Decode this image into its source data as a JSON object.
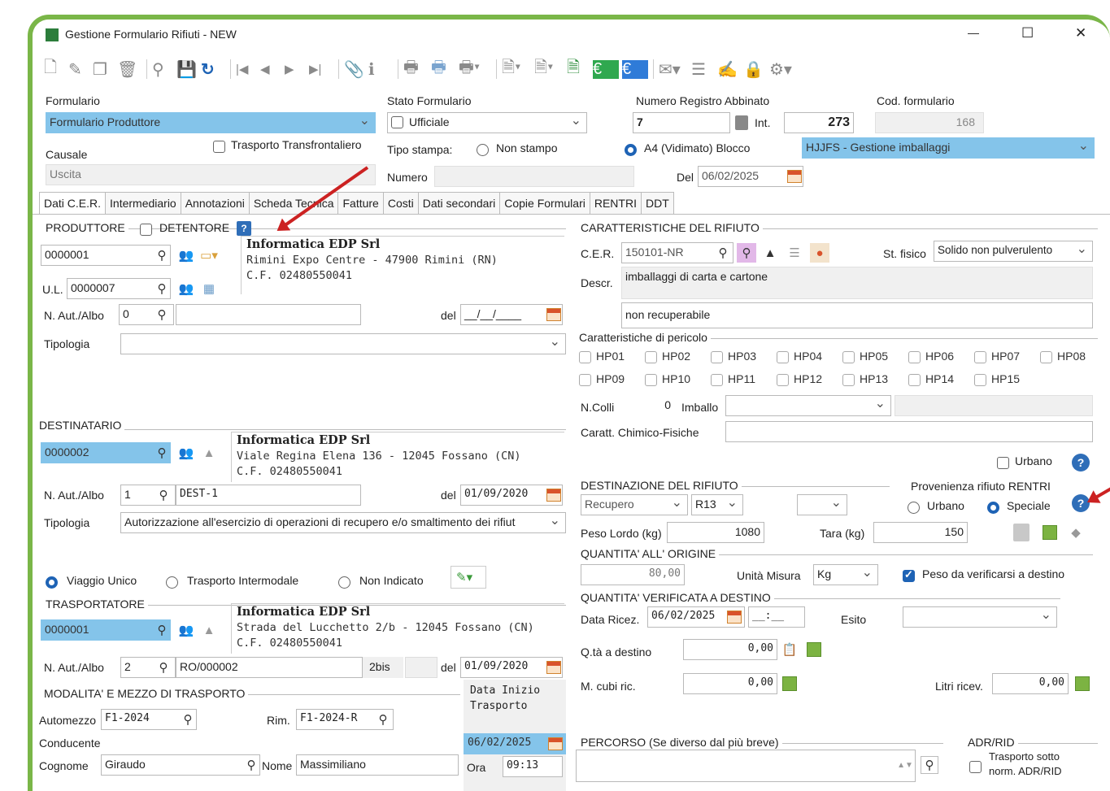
{
  "window": {
    "title": "Gestione Formulario Rifiuti - NEW",
    "min": "—",
    "max": "☐",
    "close": "✕"
  },
  "header": {
    "formulario_label": "Formulario",
    "formulario_value": "Formulario Produttore",
    "stato_label": "Stato Formulario",
    "stato_value": "Ufficiale",
    "numreg_label": "Numero Registro Abbinato",
    "numreg_value": "7",
    "int_label": "Int.",
    "int_value": "273",
    "cod_label": "Cod. formulario",
    "cod_value": "168",
    "causale_label": "Causale",
    "causale_value": "Uscita",
    "transfrontaliero_label": "Trasporto Transfrontaliero",
    "tipo_stampa_label": "Tipo stampa:",
    "non_stampo_label": "Non stampo",
    "a4_label": "A4 (Vidimato) Blocco",
    "blocco_value": "HJJFS - Gestione imballaggi",
    "numero_label": "Numero",
    "del_label": "Del",
    "del_value": "06/02/2025"
  },
  "tabs": [
    "Dati C.E.R.",
    "Intermediario",
    "Annotazioni",
    "Scheda Tecnica",
    "Fatture",
    "Costi",
    "Dati secondari",
    "Copie Formulari",
    "RENTRI",
    "DDT"
  ],
  "produttore": {
    "title": "PRODUTTORE",
    "detentore_label": "DETENTORE",
    "code": "0000001",
    "ul_label": "U.L.",
    "ul_value": "0000007",
    "name": "Informatica EDP Srl",
    "address": "Rimini Expo Centre - 47900 Rimini (RN)",
    "cf": "C.F. 02480550041",
    "aut_label": "N. Aut./Albo",
    "aut_value": "0",
    "del_label": "del",
    "del_value": "__/__/____",
    "tipologia_label": "Tipologia"
  },
  "destinatario": {
    "title": "DESTINATARIO",
    "code": "0000002",
    "name": "Informatica EDP Srl",
    "address": "Viale Regina Elena 136 - 12045 Fossano (CN)",
    "cf": "C.F. 02480550041",
    "aut_label": "N. Aut./Albo",
    "aut_value": "1",
    "aut_code": "DEST-1",
    "del_label": "del",
    "del_value": "01/09/2020",
    "tipologia_label": "Tipologia",
    "tipologia_value": "Autorizzazione all'esercizio di operazioni di recupero e/o smaltimento dei rifiut"
  },
  "viaggio": {
    "unico": "Viaggio Unico",
    "intermodale": "Trasporto Intermodale",
    "non_indicato": "Non Indicato"
  },
  "trasportatore": {
    "title": "TRASPORTATORE",
    "code": "0000001",
    "name": "Informatica EDP Srl",
    "address": "Strada del Lucchetto 2/b - 12045 Fossano (CN)",
    "cf": "C.F. 02480550041",
    "aut_label": "N. Aut./Albo",
    "aut_value": "2",
    "aut_code": "RO/000002",
    "bis_label": "2bis",
    "del_label": "del",
    "del_value": "01/09/2020"
  },
  "modalita": {
    "title": "MODALITA' E MEZZO DI TRASPORTO",
    "data_inizio_label": "Data Inizio Trasporto",
    "automezzo_label": "Automezzo",
    "automezzo_value": "F1-2024",
    "rim_label": "Rim.",
    "rim_value": "F1-2024-R",
    "conducente_label": "Conducente",
    "data_value": "06/02/2025",
    "cognome_label": "Cognome",
    "cognome_value": "Giraudo",
    "nome_label": "Nome",
    "nome_value": "Massimiliano",
    "ora_label": "Ora",
    "ora_value": "09:13"
  },
  "caratteristiche": {
    "title": "CARATTERISTICHE DEL RIFIUTO",
    "cer_label": "C.E.R.",
    "cer_value": "150101-NR",
    "st_fisico_label": "St. fisico",
    "st_fisico_value": "Solido non pulverulento",
    "descr_label": "Descr.",
    "descr_value": "imballaggi di carta e cartone",
    "descr2_value": "non recuperabile",
    "pericolo_label": "Caratteristiche di pericolo",
    "hp": [
      "HP01",
      "HP02",
      "HP03",
      "HP04",
      "HP05",
      "HP06",
      "HP07",
      "HP08",
      "HP09",
      "HP10",
      "HP11",
      "HP12",
      "HP13",
      "HP14",
      "HP15"
    ],
    "ncolli_label": "N.Colli",
    "ncolli_value": "0",
    "imballo_label": "Imballo",
    "chimico_label": "Caratt. Chimico-Fisiche",
    "urbano_label": "Urbano"
  },
  "destinazione": {
    "title": "DESTINAZIONE DEL RIFIUTO",
    "tipo_value": "Recupero",
    "codice_value": "R13",
    "provenienza_label": "Provenienza rifiuto RENTRI",
    "urbano_label": "Urbano",
    "speciale_label": "Speciale",
    "peso_lordo_label": "Peso Lordo (kg)",
    "peso_lordo_value": "1080",
    "tara_label": "Tara (kg)",
    "tara_value": "150"
  },
  "quantita": {
    "title": "QUANTITA' ALL' ORIGINE",
    "value": "80,00",
    "unita_label": "Unità Misura",
    "unita_value": "Kg",
    "verificarsi_label": "Peso da verificarsi a destino"
  },
  "verificata": {
    "title": "QUANTITA' VERIFICATA A DESTINO",
    "data_label": "Data Ricez.",
    "data_value": "06/02/2025",
    "ora_value": "__:__",
    "esito_label": "Esito",
    "qta_label": "Q.tà a destino",
    "qta_value": "0,00",
    "mcubi_label": "M. cubi ric.",
    "mcubi_value": "0,00",
    "litri_label": "Litri ricev.",
    "litri_value": "0,00"
  },
  "percorso": {
    "title": "PERCORSO (Se diverso dal più breve)",
    "adr_title": "ADR/RID",
    "adr_label_1": "Trasporto sotto",
    "adr_label_2": "norm. ADR/RID"
  },
  "colors": {
    "accent": "#84c4ea",
    "frame": "#7ab648",
    "arrow": "#cc2222",
    "help": "#2f6eb8"
  }
}
